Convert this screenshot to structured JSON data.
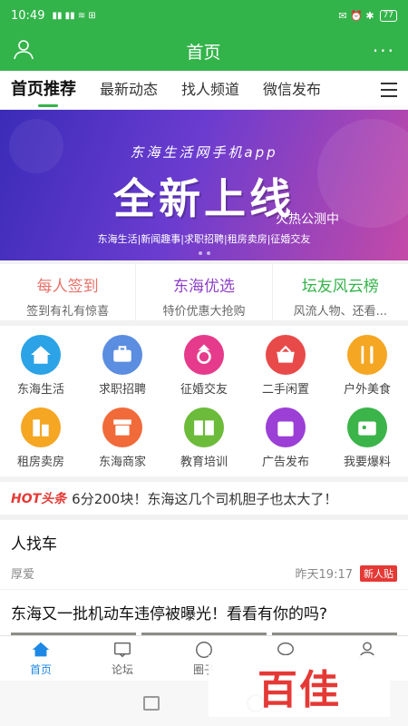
{
  "status_bar": {
    "time": "10:49",
    "signal": "▮▮ ▮▮ ≋ ⊞",
    "icons": "✉ ⏰ ✱",
    "battery": "77"
  },
  "app_bar": {
    "title": "首页"
  },
  "tabs": [
    {
      "label": "首页推荐"
    },
    {
      "label": "最新动态"
    },
    {
      "label": "找人频道"
    },
    {
      "label": "微信发布"
    }
  ],
  "banner": {
    "subtitle": "东海生活网手机app",
    "headline": "全新上线",
    "tag": "火热公测中",
    "line": "东海生活|新闻趣事|求职招聘|租房卖房|征婚交友"
  },
  "features": [
    {
      "title": "每人签到",
      "subtitle": "签到有礼有惊喜",
      "color": "#e8736b"
    },
    {
      "title": "东海优选",
      "subtitle": "特价优惠大抢购",
      "color": "#8e3fc9"
    },
    {
      "title": "坛友风云榜",
      "subtitle": "风流人物、还看...",
      "color": "#34b34a"
    }
  ],
  "grid": [
    {
      "label": "东海生活",
      "icon": "house-icon",
      "color": "#2ba3e6"
    },
    {
      "label": "求职招聘",
      "icon": "briefcase-icon",
      "color": "#5b8de0"
    },
    {
      "label": "征婚交友",
      "icon": "ring-icon",
      "color": "#e63a8c"
    },
    {
      "label": "二手闲置",
      "icon": "basket-icon",
      "color": "#e84a4a"
    },
    {
      "label": "户外美食",
      "icon": "cutlery-icon",
      "color": "#f5a623"
    },
    {
      "label": "租房卖房",
      "icon": "building-icon",
      "color": "#f5a623"
    },
    {
      "label": "东海商家",
      "icon": "store-icon",
      "color": "#f06a3a"
    },
    {
      "label": "教育培训",
      "icon": "book-icon",
      "color": "#6dbb3a"
    },
    {
      "label": "广告发布",
      "icon": "bag-icon",
      "color": "#9b3fd6"
    },
    {
      "label": "我要爆料",
      "icon": "idcard-icon",
      "color": "#3bb44a"
    }
  ],
  "hot": {
    "badge": "HOT头条",
    "text": "6分200块！东海这几个司机胆子也太大了！"
  },
  "posts": [
    {
      "title": "人找车",
      "author": "厚爱",
      "time": "昨天19:17",
      "tag": "新人贴"
    },
    {
      "title": "东海又一批机动车违停被曝光！看看有你的吗?"
    }
  ],
  "bottom_nav": [
    {
      "label": "首页",
      "icon": "home-icon"
    },
    {
      "label": "论坛",
      "icon": "forum-icon"
    },
    {
      "label": "圈子",
      "icon": "circle-icon"
    },
    {
      "label": "",
      "icon": "message-icon"
    },
    {
      "label": "",
      "icon": "profile-icon"
    }
  ],
  "watermark": "百佳"
}
